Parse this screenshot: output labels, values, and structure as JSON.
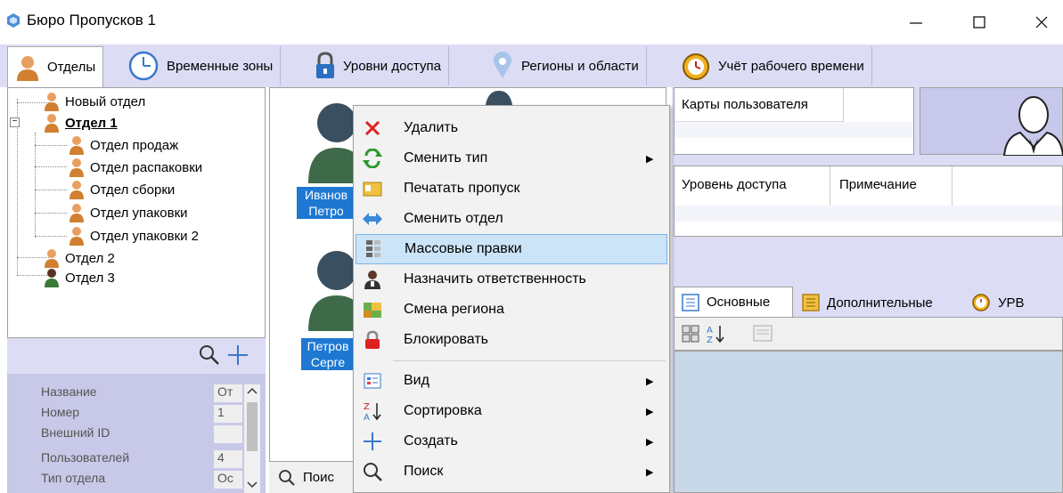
{
  "window": {
    "title": "Бюро Пропусков 1"
  },
  "tabs": [
    {
      "label": "Отделы"
    },
    {
      "label": "Временные зоны"
    },
    {
      "label": "Уровни доступа"
    },
    {
      "label": "Регионы и области"
    },
    {
      "label": "Учёт рабочего времени"
    }
  ],
  "tree": {
    "items": [
      {
        "label": "Новый отдел"
      },
      {
        "label": "Отдел 1"
      },
      {
        "label": "Отдел продаж"
      },
      {
        "label": "Отдел распаковки"
      },
      {
        "label": "Отдел сборки"
      },
      {
        "label": "Отдел упаковки"
      },
      {
        "label": "Отдел упаковки 2"
      },
      {
        "label": "Отдел 2"
      },
      {
        "label": "Отдел 3"
      }
    ]
  },
  "properties": {
    "rows": [
      {
        "key": "Название",
        "value": "От"
      },
      {
        "key": "Номер",
        "value": "1"
      },
      {
        "key": "Внешний ID",
        "value": ""
      },
      {
        "key": "Пользователей",
        "value": "4"
      },
      {
        "key": "Тип отдела",
        "value": "Ос"
      }
    ]
  },
  "users": [
    {
      "line1": "Иванов",
      "line2": "Петро"
    },
    {
      "line1": "Петров",
      "line2": "Серге"
    }
  ],
  "search_partial": "Поис",
  "right": {
    "cards_header": "Карты пользователя",
    "access_col1": "Уровень доступа",
    "access_col2": "Примечание",
    "prop_tabs": [
      "Основные",
      "Дополнительные",
      "УРВ"
    ]
  },
  "context_menu": {
    "items": [
      {
        "label": "Удалить"
      },
      {
        "label": "Сменить тип"
      },
      {
        "label": "Печатать пропуск"
      },
      {
        "label": "Сменить отдел"
      },
      {
        "label": "Массовые правки"
      },
      {
        "label": "Назначить ответственность"
      },
      {
        "label": "Смена региона"
      },
      {
        "label": "Блокировать"
      },
      {
        "label": "Вид"
      },
      {
        "label": "Сортировка"
      },
      {
        "label": "Создать"
      },
      {
        "label": "Поиск"
      }
    ]
  },
  "colors": {
    "accent": "#1e78d2",
    "tabbar": "#dcdcf4",
    "highlight": "#cce4f7"
  }
}
